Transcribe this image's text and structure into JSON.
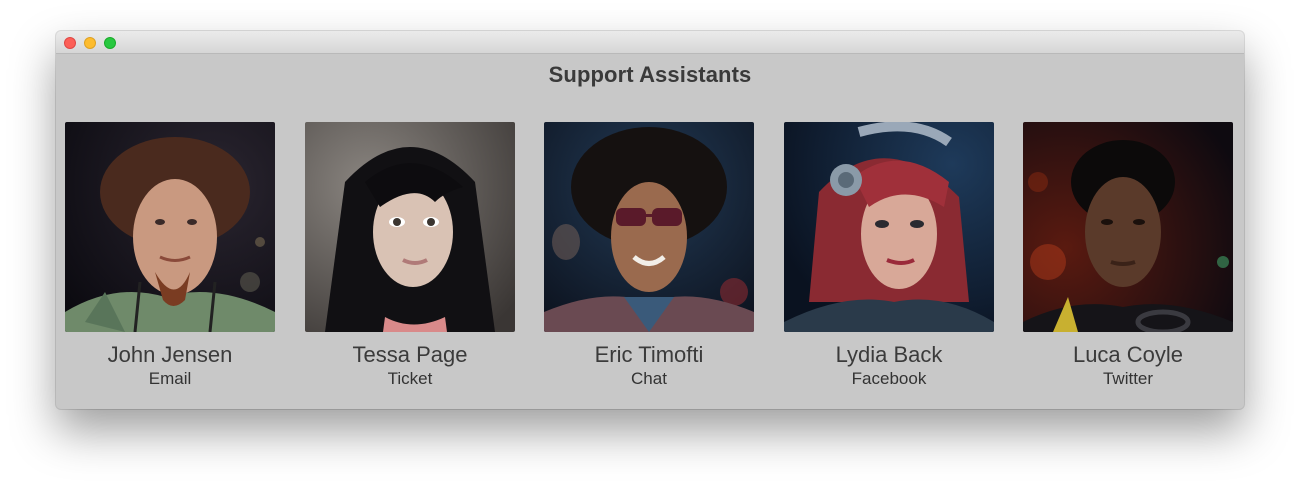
{
  "window": {
    "title": "Support Assistants"
  },
  "assistants": [
    {
      "name": "John Jensen",
      "channel": "Email",
      "avatar": "avatar-john-jensen"
    },
    {
      "name": "Tessa Page",
      "channel": "Ticket",
      "avatar": "avatar-tessa-page"
    },
    {
      "name": "Eric Timofti",
      "channel": "Chat",
      "avatar": "avatar-eric-timofti"
    },
    {
      "name": "Lydia Back",
      "channel": "Facebook",
      "avatar": "avatar-lydia-back"
    },
    {
      "name": "Luca Coyle",
      "channel": "Twitter",
      "avatar": "avatar-luca-coyle"
    }
  ],
  "colors": {
    "window_bg": "#c8c8c8",
    "close": "#fc5f57",
    "minimize": "#fdbc2e",
    "zoom": "#28c840"
  }
}
